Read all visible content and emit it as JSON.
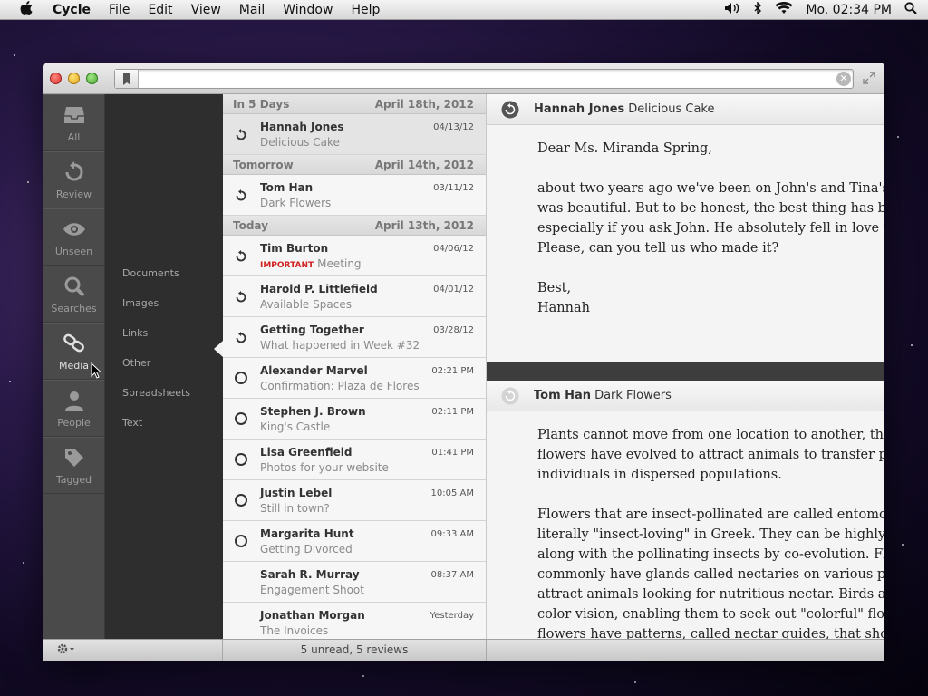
{
  "menubar": {
    "app_name": "Cycle",
    "menus": [
      "File",
      "Edit",
      "View",
      "Mail",
      "Window",
      "Help"
    ],
    "clock": "Mo. 02:34 PM"
  },
  "search": {
    "placeholder": ""
  },
  "sidebar": {
    "items": [
      {
        "label": "All",
        "icon": "inbox-icon"
      },
      {
        "label": "Review",
        "icon": "review-icon"
      },
      {
        "label": "Unseen",
        "icon": "eye-icon"
      },
      {
        "label": "Searches",
        "icon": "search-icon"
      },
      {
        "label": "Media",
        "icon": "link-icon"
      },
      {
        "label": "People",
        "icon": "person-icon"
      },
      {
        "label": "Tagged",
        "icon": "tag-icon"
      }
    ]
  },
  "subnav": {
    "items": [
      "Documents",
      "Images",
      "Links",
      "Other",
      "Spreadsheets",
      "Text"
    ]
  },
  "list": {
    "groups": [
      {
        "label": "In 5 Days",
        "date": "April 18th, 2012"
      },
      {
        "label": "Tomorrow",
        "date": "April 14th, 2012"
      },
      {
        "label": "Today",
        "date": "April 13th, 2012"
      }
    ],
    "messages": [
      {
        "from": "Hannah Jones",
        "subject": "Delicious Cake",
        "date": "04/13/12"
      },
      {
        "from": "Tom Han",
        "subject": "Dark Flowers",
        "date": "03/11/12"
      },
      {
        "from": "Tim Burton",
        "tag": "IMPORTANT",
        "subject": "Meeting",
        "date": "04/06/12"
      },
      {
        "from": "Harold P. Littlefield",
        "subject": "Available Spaces",
        "date": "04/01/12"
      },
      {
        "from": "Getting Together",
        "subject": "What happened in Week #32",
        "date": "03/28/12"
      },
      {
        "from": "Alexander Marvel",
        "subject": "Confirmation: Plaza de Flores",
        "date": "02:21 PM"
      },
      {
        "from": "Stephen J. Brown",
        "subject": "King's Castle",
        "date": "02:11 PM"
      },
      {
        "from": "Lisa Greenfield",
        "subject": "Photos for your website",
        "date": "01:41 PM"
      },
      {
        "from": "Justin Lebel",
        "subject": "Still in town?",
        "date": "10:05 AM"
      },
      {
        "from": "Margarita Hunt",
        "subject": "Getting Divorced",
        "date": "09:33 AM"
      },
      {
        "from": "Sarah R. Murray",
        "subject": "Engagement Shoot",
        "date": "08:37 AM"
      },
      {
        "from": "Jonathan Morgan",
        "subject": "The Invoices",
        "date": "Yesterday"
      }
    ]
  },
  "reader": {
    "mail1": {
      "from": "Hannah Jones",
      "subject": "Delicious Cake",
      "greeting": "Dear Ms. Miranda Spring,",
      "p1": [
        "about two years ago we've been on John's and Tina's we",
        "was beautiful. But to be honest, the best thing has been",
        "especially if you ask John. He absolutely fell in love with",
        "Please, can you tell us who made it?"
      ],
      "closing": "Best,",
      "signature": "Hannah"
    },
    "mail2": {
      "from": "Tom Han",
      "subject": "Dark Flowers",
      "p1": [
        "Plants cannot move from one location to another, thus m",
        "flowers have evolved to attract animals to transfer polle",
        "individuals in dispersed populations."
      ],
      "p2": [
        "Flowers that are insect-pollinated are called entomophil",
        "literally \"insect-loving\" in Greek. They can be highly mo",
        "along with the pollinating insects by co-evolution. Flow",
        "commonly have glands called nectaries on various parts",
        "attract animals looking for nutritious nectar. Birds and b",
        "color vision, enabling them to seek out \"colorful\" flowe",
        "flowers have patterns, called nectar guides, that show p"
      ]
    }
  },
  "status": {
    "summary": "5 unread, 5 reviews"
  },
  "colors": {
    "accent_red": "#d02020",
    "sidebar_bg": "#4a4a4a",
    "subnav_bg": "#2e2e2e"
  }
}
